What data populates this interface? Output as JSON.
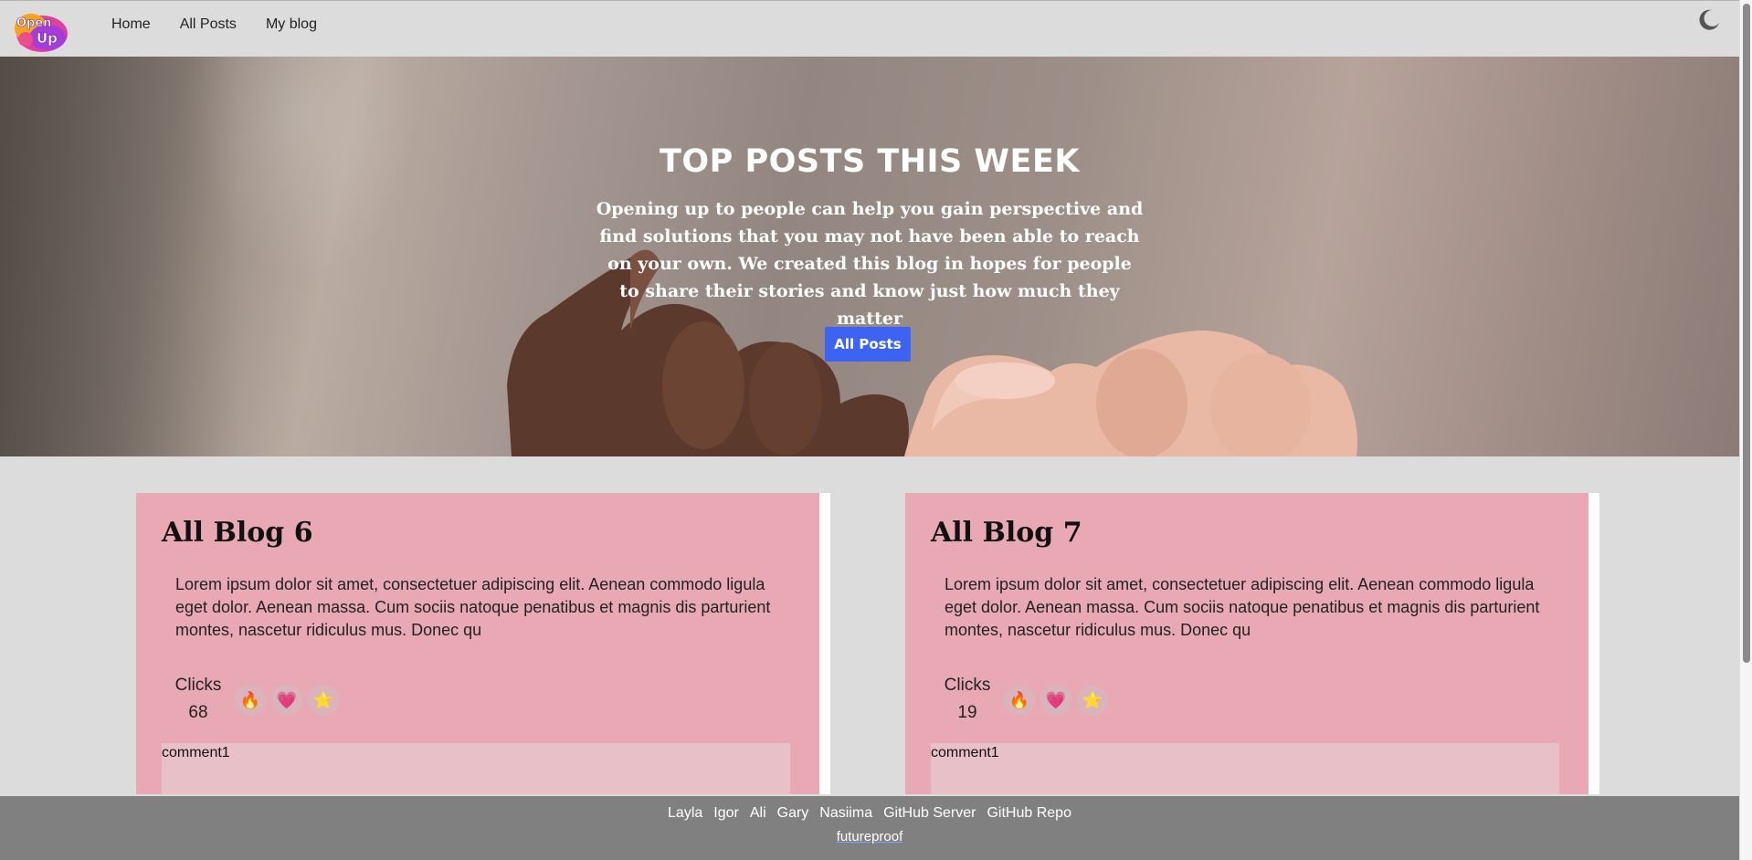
{
  "nav": {
    "logo_text": "Open Up",
    "links": [
      "Home",
      "All Posts",
      "My blog"
    ]
  },
  "hero": {
    "title": "TOP POSTS THIS WEEK",
    "subtitle": "Opening up to people can help you gain perspective and find solutions that you may not have been able to reach on your own. We created this blog in hopes for people to share their stories and know just how much they matter",
    "button_label": "All Posts"
  },
  "cards": [
    {
      "title": "All Blog 6",
      "body": "Lorem ipsum dolor sit amet, consectetuer adipiscing elit. Aenean commodo ligula eget dolor. Aenean massa. Cum sociis natoque penatibus et magnis dis parturient montes, nascetur ridiculus mus. Donec qu",
      "clicks_label": "Clicks",
      "clicks_count": "68",
      "reactions": [
        "🔥",
        "💗",
        "⭐"
      ],
      "comment": "comment1"
    },
    {
      "title": "All Blog 7",
      "body": "Lorem ipsum dolor sit amet, consectetuer adipiscing elit. Aenean commodo ligula eget dolor. Aenean massa. Cum sociis natoque penatibus et magnis dis parturient montes, nascetur ridiculus mus. Donec qu",
      "clicks_label": "Clicks",
      "clicks_count": "19",
      "reactions": [
        "🔥",
        "💗",
        "⭐"
      ],
      "comment": "comment1"
    }
  ],
  "footer": {
    "links": [
      "Layla",
      "Igor",
      "Ali",
      "Gary",
      "Nasiima",
      "GitHub Server",
      "GitHub Repo"
    ],
    "tagline": "futureproof"
  },
  "colors": {
    "card_bg": "#e8a9b5",
    "button_blue": "#3d63f5",
    "footer_bg": "#808080"
  }
}
